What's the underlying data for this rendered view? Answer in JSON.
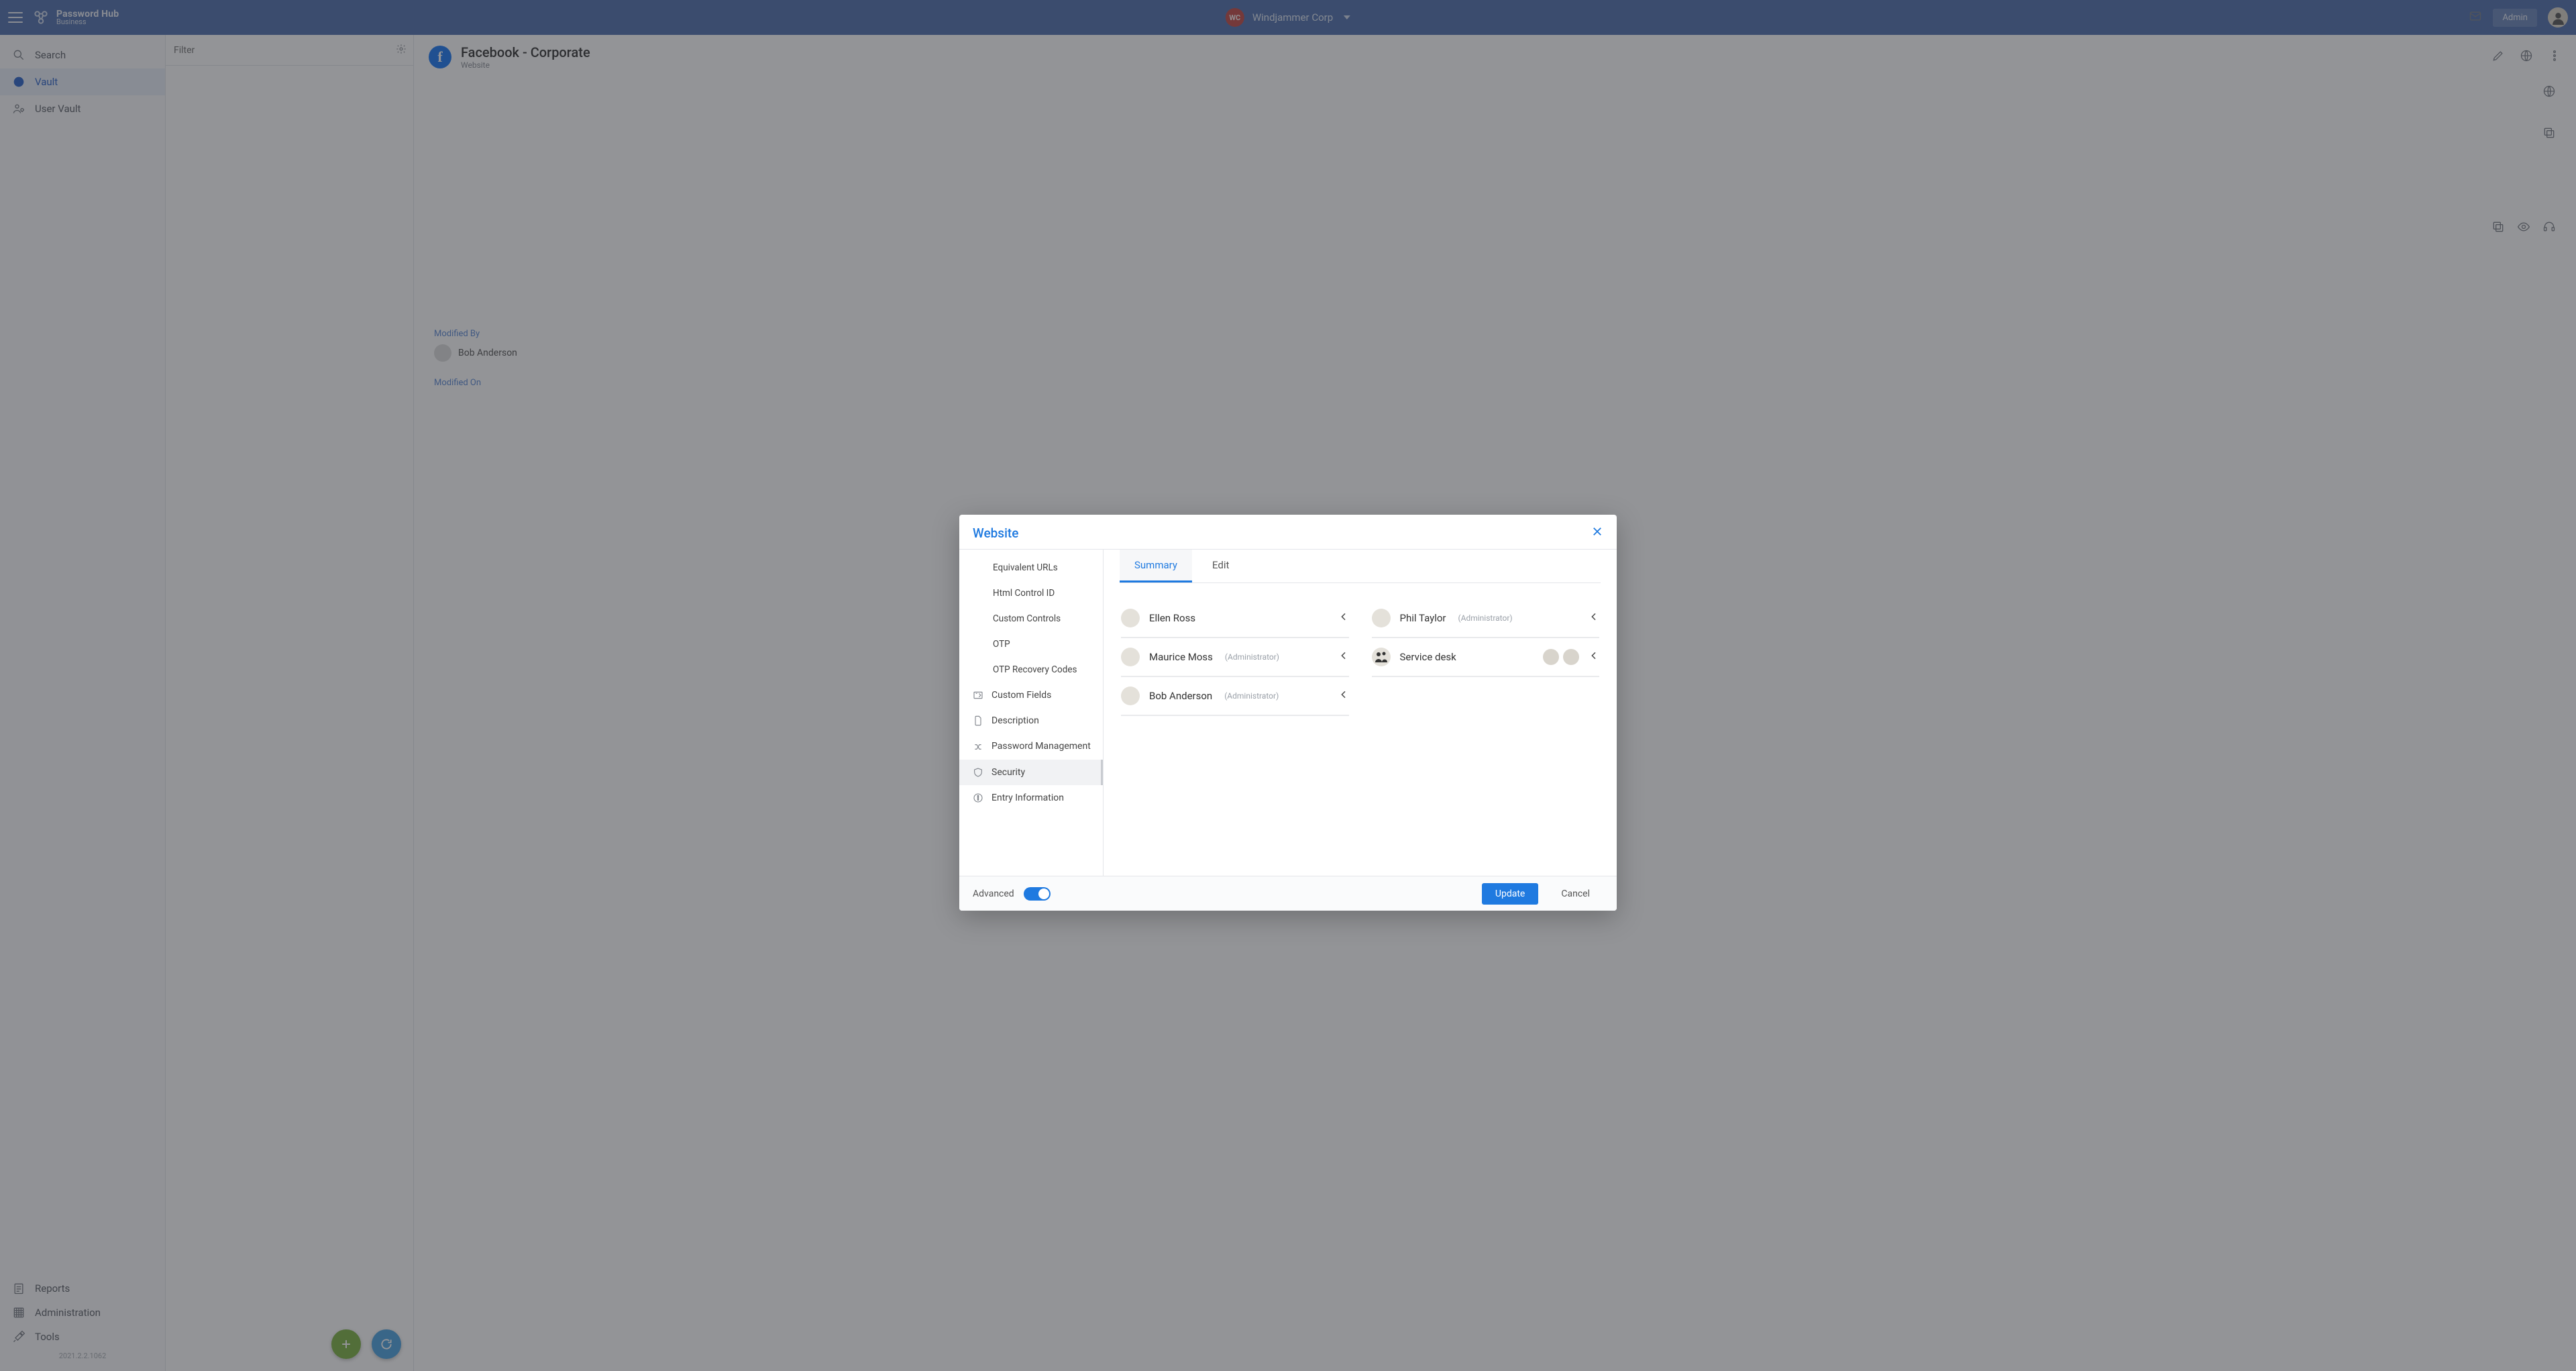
{
  "app": {
    "name_l1": "Password Hub",
    "name_l2": "Business",
    "version": "2021.2.2.1062"
  },
  "topbar": {
    "org_initials": "WC",
    "org_name": "Windjammer Corp",
    "admin_btn": "Admin"
  },
  "leftnav": {
    "search": "Search",
    "vault": "Vault",
    "user_vault": "User Vault",
    "reports": "Reports",
    "administration": "Administration",
    "tools": "Tools"
  },
  "filter": {
    "placeholder": "Filter"
  },
  "entry": {
    "title": "Facebook - Corporate",
    "subtype": "Website",
    "modified_by_label": "Modified By",
    "modified_by": "Bob Anderson",
    "modified_on_label": "Modified On"
  },
  "modal": {
    "title": "Website",
    "side": {
      "equivalent_urls": "Equivalent URLs",
      "html_control_id": "Html Control ID",
      "custom_controls": "Custom Controls",
      "otp": "OTP",
      "otp_recovery": "OTP Recovery Codes",
      "custom_fields": "Custom Fields",
      "description": "Description",
      "password_mgmt": "Password Management",
      "security": "Security",
      "entry_info": "Entry Information"
    },
    "tabs": {
      "summary": "Summary",
      "edit": "Edit"
    },
    "admin_note": "(Administrator)",
    "principals": [
      {
        "name": "Ellen Ross",
        "admin": false,
        "is_group": false
      },
      {
        "name": "Phil Taylor",
        "admin": true,
        "is_group": false
      },
      {
        "name": "Maurice Moss",
        "admin": true,
        "is_group": false
      },
      {
        "name": "Service desk",
        "admin": false,
        "is_group": true
      },
      {
        "name": "Bob Anderson",
        "admin": true,
        "is_group": false
      }
    ],
    "footer": {
      "advanced": "Advanced",
      "update": "Update",
      "cancel": "Cancel"
    }
  }
}
